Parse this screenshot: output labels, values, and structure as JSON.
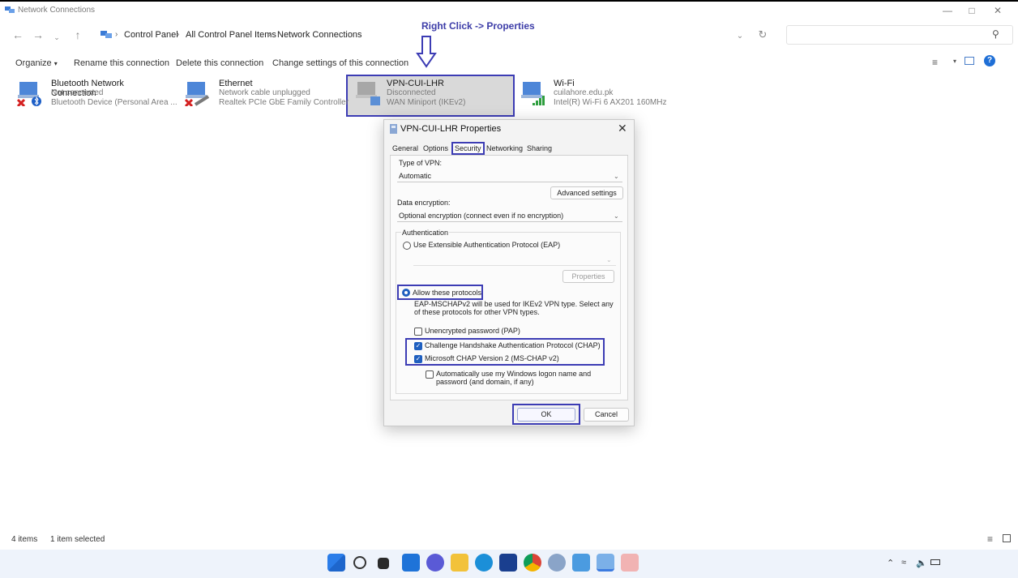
{
  "window": {
    "title": "Network Connections"
  },
  "annotation": {
    "text": "Right Click -> Properties"
  },
  "breadcrumb": [
    "Control Panel",
    "All Control Panel Items",
    "Network Connections"
  ],
  "commands": [
    "Organize",
    "Rename this connection",
    "Delete this connection",
    "Change settings of this connection"
  ],
  "connections": [
    {
      "name": "Bluetooth Network Connection",
      "status": "Not connected",
      "device": "Bluetooth Device (Personal Area ...",
      "icon": "bluetooth-network-icon"
    },
    {
      "name": "Ethernet",
      "status": "Network cable unplugged",
      "device": "Realtek PCIe GbE Family Controller",
      "icon": "ethernet-network-icon"
    },
    {
      "name": "VPN-CUI-LHR",
      "status": "Disconnected",
      "device": "WAN Miniport (IKEv2)",
      "icon": "vpn-network-icon"
    },
    {
      "name": "Wi-Fi",
      "status": "cuilahore.edu.pk",
      "device": "Intel(R) Wi-Fi 6 AX201 160MHz",
      "icon": "wifi-network-icon"
    }
  ],
  "dialog": {
    "title": "VPN-CUI-LHR Properties",
    "tabs": [
      "General",
      "Options",
      "Security",
      "Networking",
      "Sharing"
    ],
    "active_tab": "Security",
    "type_of_vpn_label": "Type of VPN:",
    "type_of_vpn_value": "Automatic",
    "advanced_settings": "Advanced settings",
    "data_encryption_label": "Data encryption:",
    "data_encryption_value": "Optional encryption (connect even if no encryption)",
    "authentication_label": "Authentication",
    "eap_option": "Use Extensible Authentication Protocol (EAP)",
    "properties_button": "Properties",
    "allow_option": "Allow these protocols",
    "note_line1": "EAP-MSCHAPv2 will be used for IKEv2 VPN type. Select any",
    "note_line2": "of these protocols for other VPN types.",
    "pap": "Unencrypted password (PAP)",
    "chap": "Challenge Handshake Authentication Protocol (CHAP)",
    "mschap": "Microsoft CHAP Version 2 (MS-CHAP v2)",
    "autologon_line1": "Automatically use my Windows logon name and",
    "autologon_line2": "password (and domain, if any)",
    "ok": "OK",
    "cancel": "Cancel",
    "state": {
      "eap_selected": false,
      "allow_selected": true,
      "pap_checked": false,
      "chap_checked": true,
      "mschap_checked": true,
      "autologon_checked": false
    }
  },
  "status_bar": {
    "items": "4 items",
    "selected": "1 item selected"
  },
  "colors": {
    "highlight": "#3c3cb4",
    "accent": "#1f5fbf",
    "selection": "#d9d9d9"
  }
}
